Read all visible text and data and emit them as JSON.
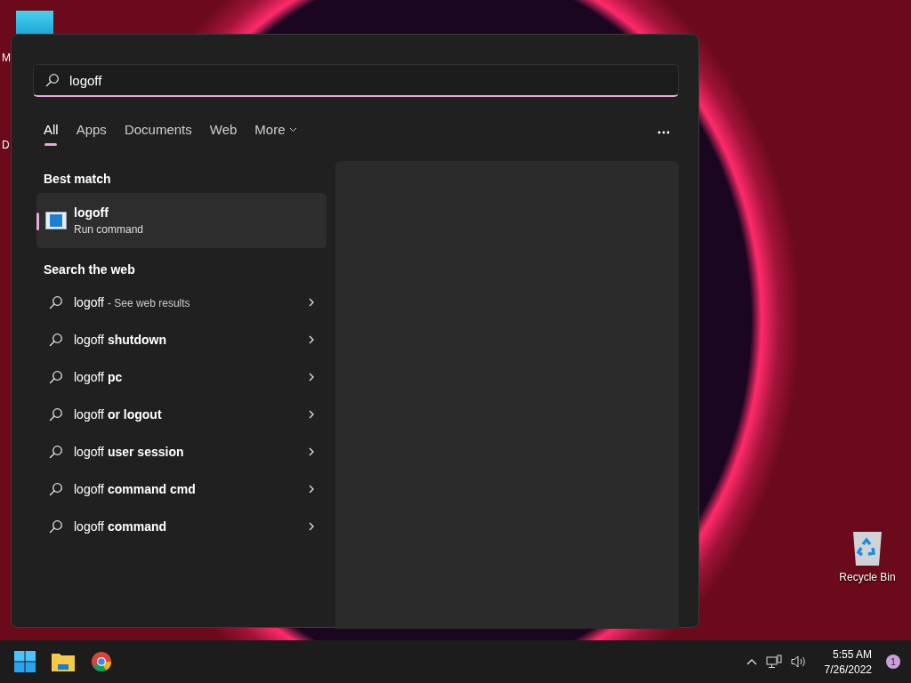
{
  "desktop": {
    "partial_labels": [
      "M",
      "D"
    ],
    "recycle_bin": {
      "label": "Recycle Bin"
    }
  },
  "search_panel": {
    "search": {
      "value": "logoff"
    },
    "tabs": [
      {
        "label": "All",
        "selected": true,
        "kind": "plain"
      },
      {
        "label": "Apps",
        "selected": false,
        "kind": "plain"
      },
      {
        "label": "Documents",
        "selected": false,
        "kind": "plain"
      },
      {
        "label": "Web",
        "selected": false,
        "kind": "plain"
      },
      {
        "label": "More",
        "selected": false,
        "kind": "dropdown"
      }
    ],
    "best_match": {
      "heading": "Best match",
      "title": "logoff",
      "subtitle": "Run command",
      "selected": true
    },
    "web": {
      "heading": "Search the web",
      "items": [
        {
          "kind": "see_results",
          "query": "logoff",
          "hint": "- See web results"
        },
        {
          "kind": "suggestion",
          "text": "logoff **shutdown**"
        },
        {
          "kind": "suggestion",
          "text": "logoff **pc**"
        },
        {
          "kind": "suggestion",
          "text": "logoff **or logout**"
        },
        {
          "kind": "suggestion",
          "text": "logoff **user session**"
        },
        {
          "kind": "suggestion",
          "text": "logoff **command cmd**"
        },
        {
          "kind": "suggestion",
          "text": "logoff **command**"
        }
      ]
    }
  },
  "taskbar": {
    "time": "5:55 AM",
    "date": "7/26/2022",
    "notifications": "1"
  }
}
